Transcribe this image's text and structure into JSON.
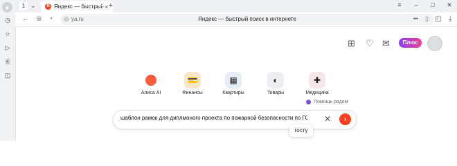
{
  "browser": {
    "tab_count": "1",
    "tab": {
      "favicon_letter": "Я",
      "title": "Яндекс — быстрый поиск в интернете"
    },
    "address": {
      "url": "ya.ru",
      "title": "Яндекс — быстрый поиск в интернете"
    }
  },
  "header": {
    "plus_label": "Плюс"
  },
  "services": [
    {
      "label": "Алиса AI",
      "icon": "alice-icon"
    },
    {
      "label": "Финансы",
      "icon": "finance-icon"
    },
    {
      "label": "Квартиры",
      "icon": "apartments-icon"
    },
    {
      "label": "Товары",
      "icon": "goods-icon"
    },
    {
      "label": "Медицина",
      "icon": "medicine-icon"
    }
  ],
  "helper": {
    "label": "Помощь рядом"
  },
  "search": {
    "value": "шаблон рамок для диплмоного проекта по пожарной безопасности по ГОСТ",
    "suggestion": "госту"
  },
  "colors": {
    "accent": "#fc3f1d",
    "plus_start": "#8a3ffc",
    "plus_end": "#f03d90"
  }
}
